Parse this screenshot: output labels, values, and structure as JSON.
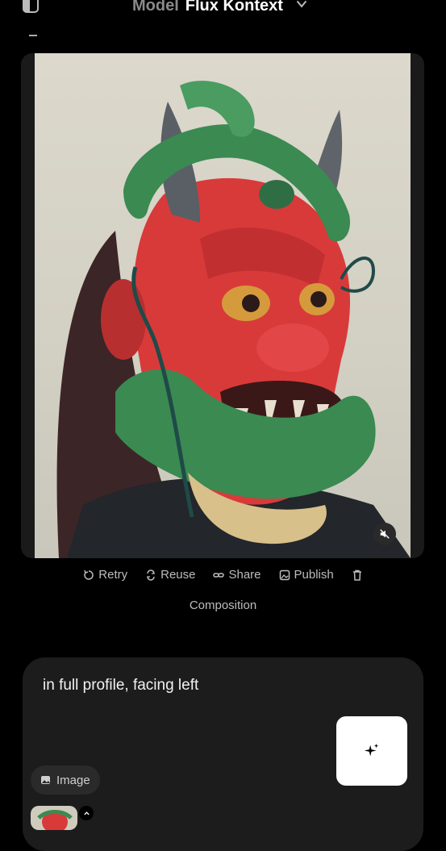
{
  "header": {
    "model_prefix": "Model",
    "model_name": "Flux Kontext"
  },
  "image": {
    "alt": "Red oni mask with green snakes coiled around horns and jaw"
  },
  "actions": {
    "retry": "Retry",
    "reuse": "Reuse",
    "share": "Share",
    "publish": "Publish"
  },
  "tag": "Composition",
  "prompt": {
    "text": "in full profile, facing left",
    "image_chip_label": "Image"
  },
  "colors": {
    "background": "#000000",
    "panel": "#1c1c1c",
    "mask_red": "#d83a3a",
    "snake_green": "#3a8a52"
  }
}
